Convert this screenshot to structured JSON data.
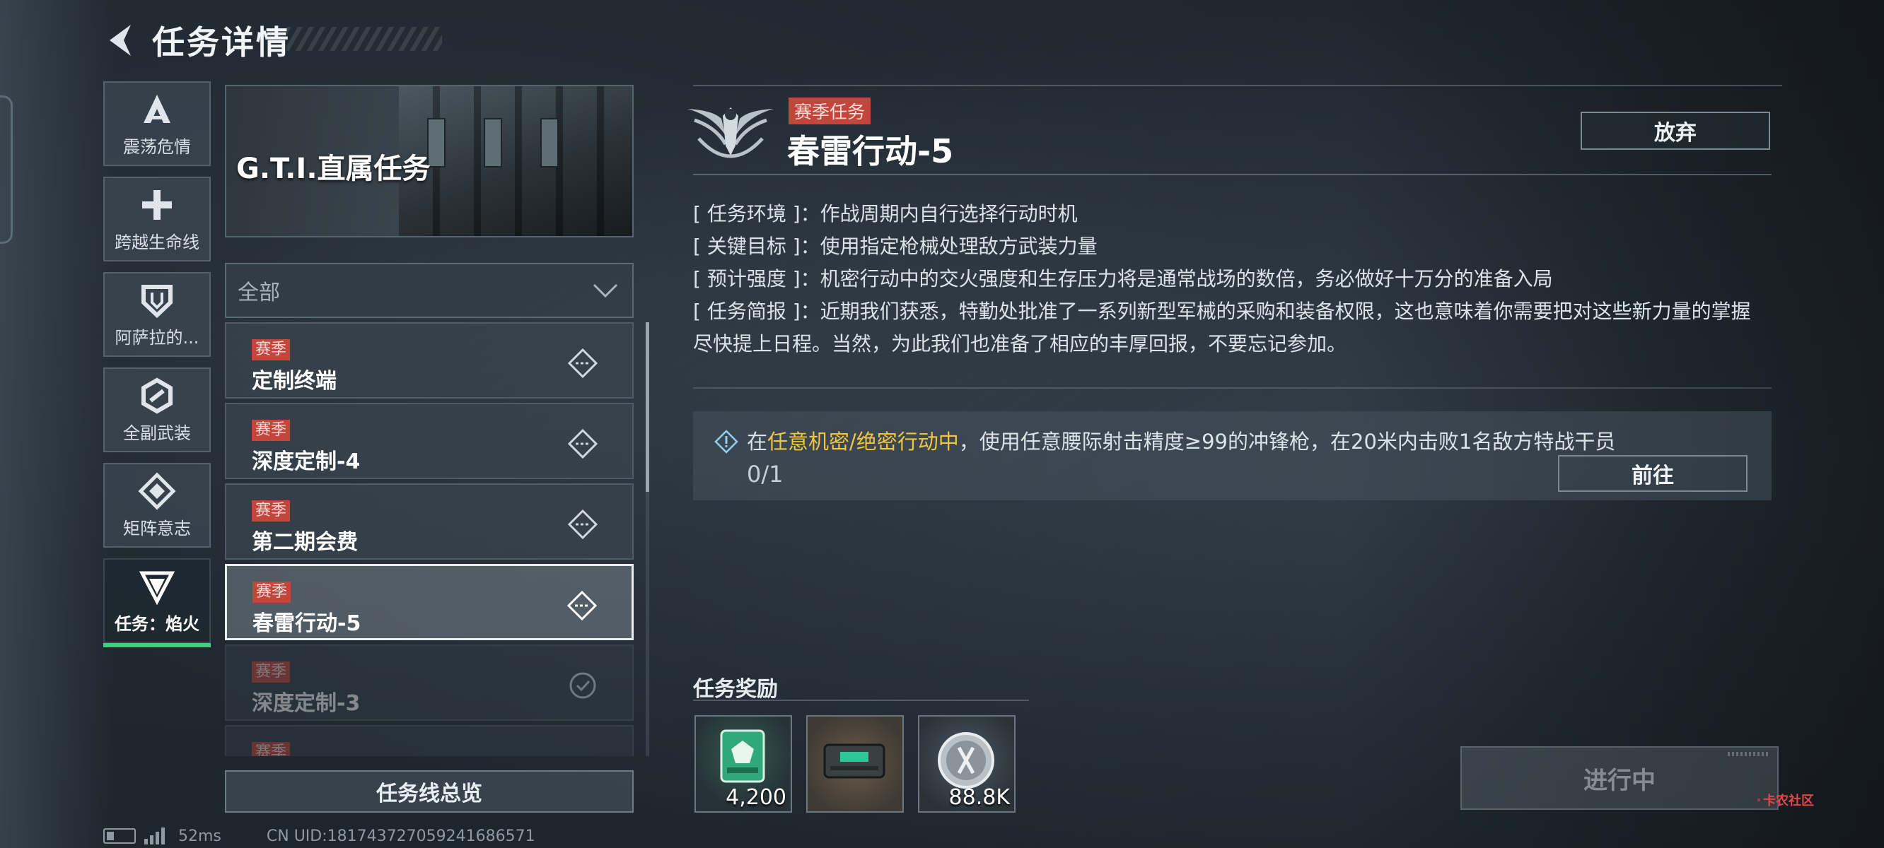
{
  "header": {
    "title": "任务详情"
  },
  "sidebar": {
    "items": [
      {
        "label": "震荡危情",
        "icon": "a-chevron-icon"
      },
      {
        "label": "跨越生命线",
        "icon": "cross-icon"
      },
      {
        "label": "阿萨拉的...",
        "icon": "shield-icon"
      },
      {
        "label": "全副武装",
        "icon": "hex-link-icon"
      },
      {
        "label": "矩阵意志",
        "icon": "diamond-icon"
      },
      {
        "label": "任务：焰火",
        "icon": "triangle-g-icon",
        "active": true
      }
    ]
  },
  "banner": {
    "title": "G.T.I.直属任务"
  },
  "filter": {
    "value": "全部"
  },
  "missions": [
    {
      "tag": "赛季",
      "name": "定制终端",
      "state": "available"
    },
    {
      "tag": "赛季",
      "name": "深度定制-4",
      "state": "available"
    },
    {
      "tag": "赛季",
      "name": "第二期会费",
      "state": "available"
    },
    {
      "tag": "赛季",
      "name": "春雷行动-5",
      "state": "selected"
    },
    {
      "tag": "赛季",
      "name": "深度定制-3",
      "state": "done"
    },
    {
      "tag": "赛季",
      "name": "",
      "state": "done"
    }
  ],
  "overview_button": "任务线总览",
  "status": {
    "ping": "52ms",
    "uid": "CN UID:181743727059241686571"
  },
  "detail": {
    "season_tag": "赛季任务",
    "title": "春雷行动-5",
    "abandon_label": "放弃",
    "info": [
      {
        "key": "[ 任务环境 ]：",
        "value": "作战周期内自行选择行动时机"
      },
      {
        "key": "[ 关键目标 ]：",
        "value": "使用指定枪械处理敌方武装力量"
      },
      {
        "key": "[ 预计强度 ]：",
        "value": "机密行动中的交火强度和生存压力将是通常战场的数倍，务必做好十万分的准备入局"
      },
      {
        "key": "[ 任务简报 ]：",
        "value": "近期我们获悉，特勤处批准了一系列新型军械的采购和装备权限，这也意味着你需要把对这些新力量的掌握尽快提上日程。当然，为此我们也准备了相应的丰厚回报，不要忘记参加。"
      }
    ],
    "objective": {
      "prefix": "在",
      "highlight": "任意机密/绝密行动中",
      "suffix": "，使用任意腰际射击精度≥99的冲锋枪，在20米内击败1名敌方特战干员",
      "progress": "0/1",
      "goto_label": "前往"
    },
    "reward_title": "任务奖励",
    "rewards": [
      {
        "icon": "green-badge-icon",
        "qty": "4,200"
      },
      {
        "icon": "case-icon",
        "qty": ""
      },
      {
        "icon": "silver-coin-icon",
        "qty": "88.8K"
      }
    ],
    "status_button": "进行中"
  },
  "watermark": {
    "text": "卡农社区"
  },
  "colors": {
    "accent_green": "#3fd07a",
    "season_red": "#c2463c",
    "highlight_yellow": "#f0c640"
  }
}
